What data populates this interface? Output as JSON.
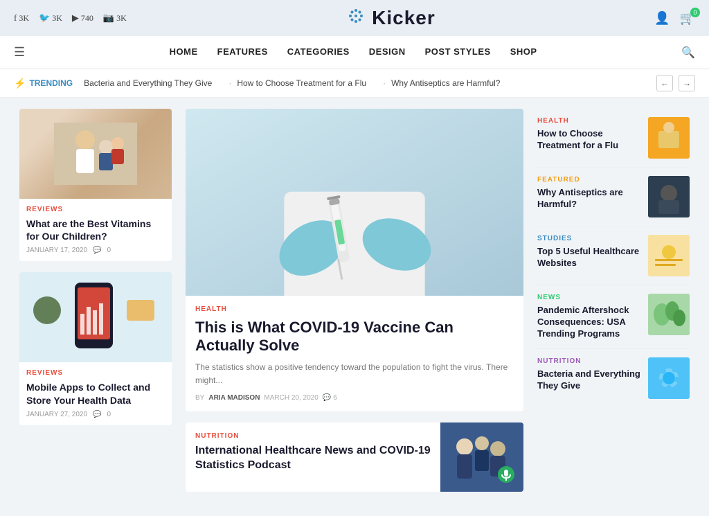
{
  "site": {
    "name": "Kicker",
    "logo_icon": "✦"
  },
  "social": [
    {
      "platform": "f",
      "count": "3K"
    },
    {
      "platform": "🐦",
      "count": "3K"
    },
    {
      "platform": "▶",
      "count": "740"
    },
    {
      "platform": "📷",
      "count": "3K"
    }
  ],
  "nav": {
    "items": [
      {
        "label": "HOME"
      },
      {
        "label": "FEATURES"
      },
      {
        "label": "CATEGORIES"
      },
      {
        "label": "DESIGN"
      },
      {
        "label": "POST STYLES"
      },
      {
        "label": "SHOP"
      }
    ]
  },
  "trending": {
    "label": "TRENDING",
    "items": [
      "Bacteria and Everything They Give",
      "How to Choose Treatment for a Flu",
      "Why Antiseptics are Harmful?"
    ]
  },
  "left_cards": [
    {
      "category": "REVIEWS",
      "title": "What are the Best Vitamins for Our Children?",
      "date": "JANUARY 17, 2020",
      "comments": "0"
    },
    {
      "category": "REVIEWS",
      "title": "Mobile Apps to Collect and Store Your Health Data",
      "date": "JANUARY 27, 2020",
      "comments": "0"
    }
  ],
  "featured": {
    "category": "HEALTH",
    "title": "This is What COVID-19 Vaccine Can Actually Solve",
    "excerpt": "The statistics show a positive tendency toward the population to fight the virus. There might...",
    "author": "ARIA MADISON",
    "date": "MARCH 20, 2020",
    "comments": "6"
  },
  "bottom_article": {
    "category": "NUTRITION",
    "title": "International Healthcare News and COVID-19 Statistics Podcast"
  },
  "right_items": [
    {
      "category": "HEALTH",
      "category_class": "health",
      "title": "How to Choose Treatment for a Flu"
    },
    {
      "category": "FEATURED",
      "category_class": "featured",
      "title": "Why Antiseptics are Harmful?"
    },
    {
      "category": "STUDIES",
      "category_class": "studies",
      "title": "Top 5 Useful Healthcare Websites"
    },
    {
      "category": "NEWS",
      "category_class": "news",
      "title": "Pandemic Aftershock Consequences: USA Trending Programs"
    },
    {
      "category": "NUTRITION",
      "category_class": "nutrition",
      "title": "Bacteria and Everything They Give"
    }
  ],
  "labels": {
    "by": "BY",
    "trending": "TRENDING"
  }
}
